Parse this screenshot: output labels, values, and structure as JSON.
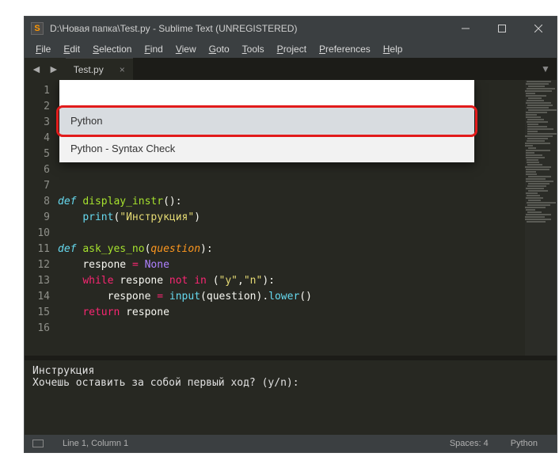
{
  "titlebar": {
    "icon_letter": "S",
    "title": "D:\\Новая папка\\Test.py - Sublime Text (UNREGISTERED)"
  },
  "menus": [
    {
      "key": "F",
      "rest": "ile"
    },
    {
      "key": "E",
      "rest": "dit"
    },
    {
      "key": "S",
      "rest": "election"
    },
    {
      "key": "F",
      "rest": "ind"
    },
    {
      "key": "V",
      "rest": "iew"
    },
    {
      "key": "G",
      "rest": "oto"
    },
    {
      "key": "T",
      "rest": "ools"
    },
    {
      "key": "P",
      "rest": "roject"
    },
    {
      "key": "P",
      "rest": "references"
    },
    {
      "key": "H",
      "rest": "elp"
    }
  ],
  "tab": {
    "label": "Test.py"
  },
  "palette_items": [
    {
      "label": "Python",
      "selected": true
    },
    {
      "label": "Python - Syntax Check",
      "selected": false
    }
  ],
  "line_count": 16,
  "console": {
    "line1": "Инструкция",
    "line2": "Хочешь оставить за собой первый ход? (y/n):"
  },
  "status": {
    "pos": "Line 1, Column 1",
    "spaces": "Spaces: 4",
    "syntax": "Python"
  },
  "code": {
    "l8a": "def",
    "l8b": "display_instr",
    "l8c": "():",
    "l9a": "print",
    "l9b": "(",
    "l9c": "\"Инструкция\"",
    "l9d": ")",
    "l11a": "def",
    "l11b": "ask_yes_no",
    "l11c": "(",
    "l11d": "question",
    "l11e": "):",
    "l12a": "respone ",
    "l12b": "=",
    "l12c": " None",
    "l13a": "while",
    "l13b": " respone ",
    "l13c": "not",
    "l13d": " ",
    "l13e": "in",
    "l13f": " (",
    "l13g": "\"y\"",
    "l13h": ",",
    "l13i": "\"n\"",
    "l13j": "):",
    "l14a": "respone ",
    "l14b": "=",
    "l14c": " ",
    "l14d": "input",
    "l14e": "(question).",
    "l14f": "lower",
    "l14g": "()",
    "l15a": "return",
    "l15b": " respone"
  }
}
